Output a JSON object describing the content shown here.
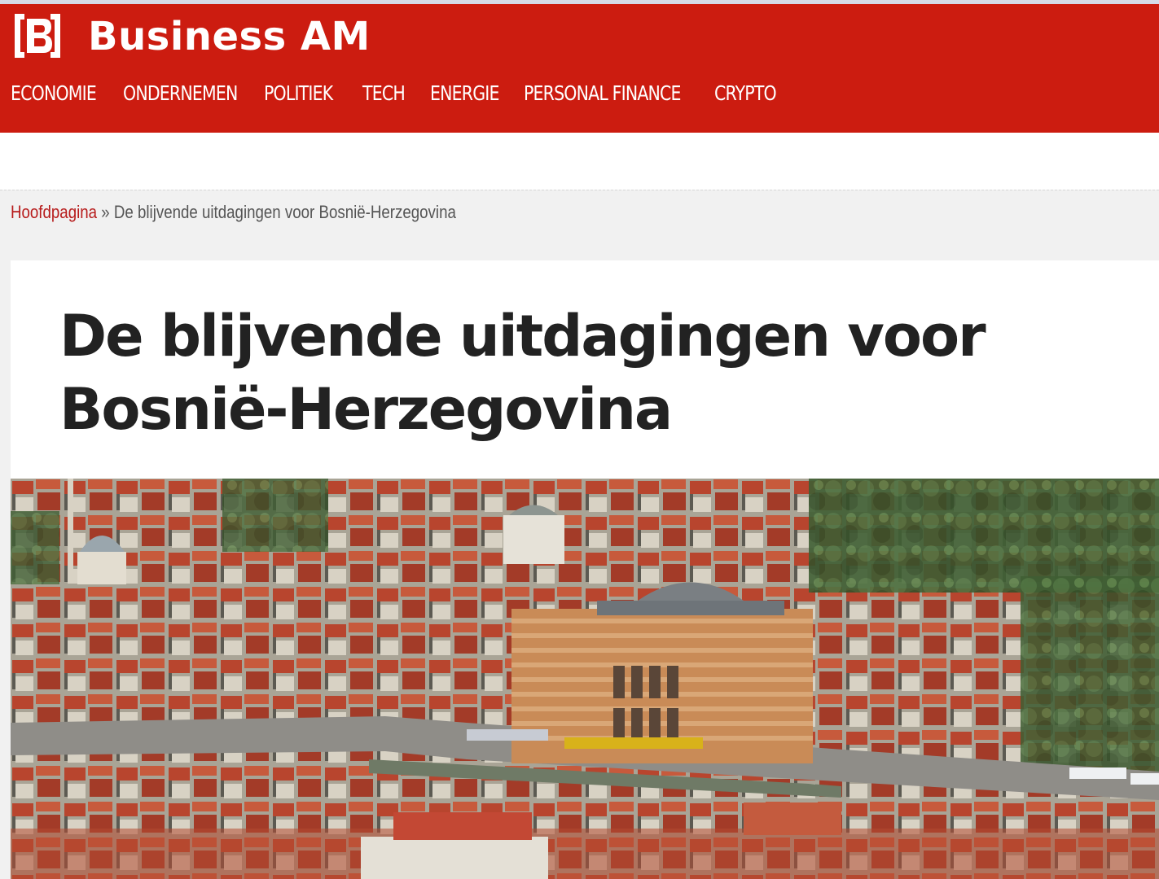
{
  "site": {
    "brand": "Business AM",
    "colors": {
      "header_red": "#cc1c10",
      "link_red": "#b71c1c",
      "title": "#222222"
    }
  },
  "nav": {
    "items": [
      {
        "label": "ECONOMIE"
      },
      {
        "label": "ONDERNEMEN"
      },
      {
        "label": "POLITIEK"
      },
      {
        "label": "TECH"
      },
      {
        "label": "ENERGIE"
      },
      {
        "label": "PERSONAL FINANCE"
      },
      {
        "label": "CRYPTO"
      }
    ]
  },
  "breadcrumb": {
    "home": "Hoofdpagina",
    "separator": "»",
    "current": "De blijvende uitdagingen voor Bosnië-Herzegovina"
  },
  "article": {
    "title": "De blijvende uitdagingen voor Bosnië-Herzegovina",
    "hero_image": {
      "icon": "city-photo"
    }
  }
}
